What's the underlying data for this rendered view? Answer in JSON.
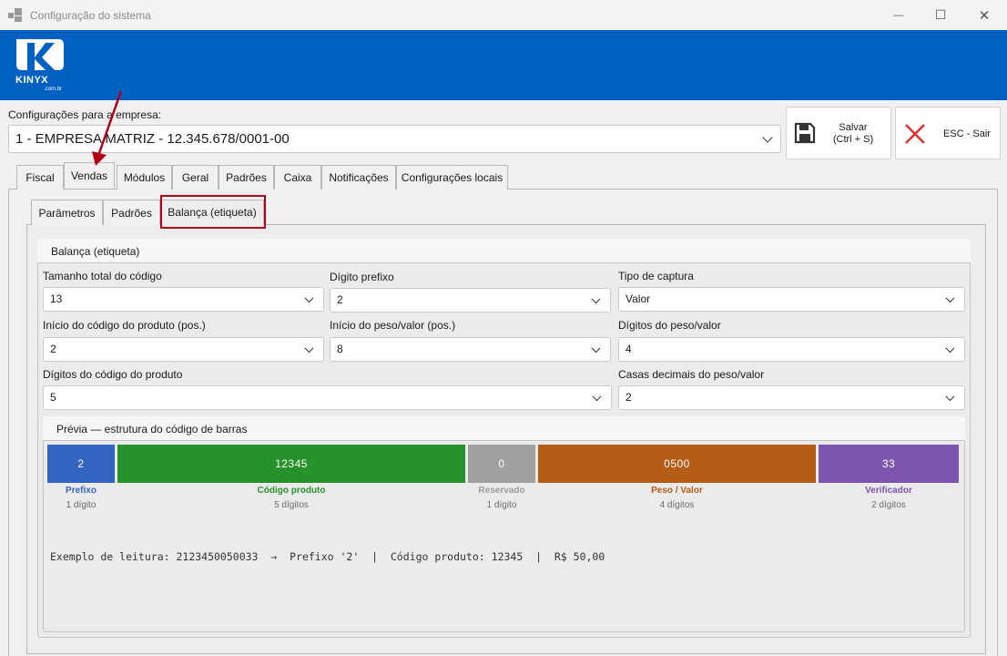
{
  "window": {
    "title": "Configuração do sistema",
    "minimize": "—",
    "maximize": "☐",
    "close": "✕"
  },
  "brand": {
    "logo_text": "KINYX",
    "logo_sub": ".com.br",
    "color": "#0061c3"
  },
  "empresa": {
    "label": "Configurações para a empresa:",
    "selected": "1 - EMPRESA MATRIZ - 12.345.678/0001-00"
  },
  "toolbar": {
    "save_label": "Salvar\n(Ctrl + S)",
    "exit_label": "ESC - Sair"
  },
  "tabs": [
    "Fiscal",
    "Vendas",
    "Módulos",
    "Geral",
    "Padrões",
    "Caixa",
    "Notificações",
    "Configurações locais"
  ],
  "subtabs": [
    "Parâmetros",
    "Padrões",
    "Balança (etiqueta)"
  ],
  "group": {
    "title": "Balança (etiqueta)",
    "fields": {
      "tamanho_label": "Tamanho total do código",
      "tamanho_value": "13",
      "prefixo_label": "Dígito prefixo",
      "prefixo_value": "2",
      "captura_label": "Tipo de captura",
      "captura_value": "Valor",
      "inicio_prod_label": "Início do código do produto (pos.)",
      "inicio_prod_value": "2",
      "inicio_peso_label": "Início do peso/valor (pos.)",
      "inicio_peso_value": "8",
      "digitos_peso_label": "Dígitos do peso/valor",
      "digitos_peso_value": "4",
      "digitos_prod_label": "Dígitos do código do produto",
      "digitos_prod_value": "5",
      "casas_label": "Casas decimais do peso/valor",
      "casas_value": "2"
    }
  },
  "preview": {
    "title": "Prévia — estrutura do código de barras",
    "segments": [
      {
        "value": "2",
        "label": "Prefixo",
        "sub": "1 dígito",
        "color": "#3264c0",
        "label_color": "#3264c0"
      },
      {
        "value": "12345",
        "label": "Código produto",
        "sub": "5 dígitos",
        "color": "#26922a",
        "label_color": "#26922a"
      },
      {
        "value": "0",
        "label": "Reservado",
        "sub": "1 dígito",
        "color": "#a0a0a0",
        "label_color": "#9a9a9a"
      },
      {
        "value": "0500",
        "label": "Peso / Valor",
        "sub": "4 dígitos",
        "color": "#b55c17",
        "label_color": "#b55c17"
      },
      {
        "value": "33",
        "label": "Verificador",
        "sub": "2 dígitos",
        "color": "#7e55ae",
        "label_color": "#7e55ae"
      }
    ],
    "example": "Exemplo de leitura: 2123450050033  →  Prefixo '2'  |  Código produto: 12345  |  R$ 50,00"
  }
}
